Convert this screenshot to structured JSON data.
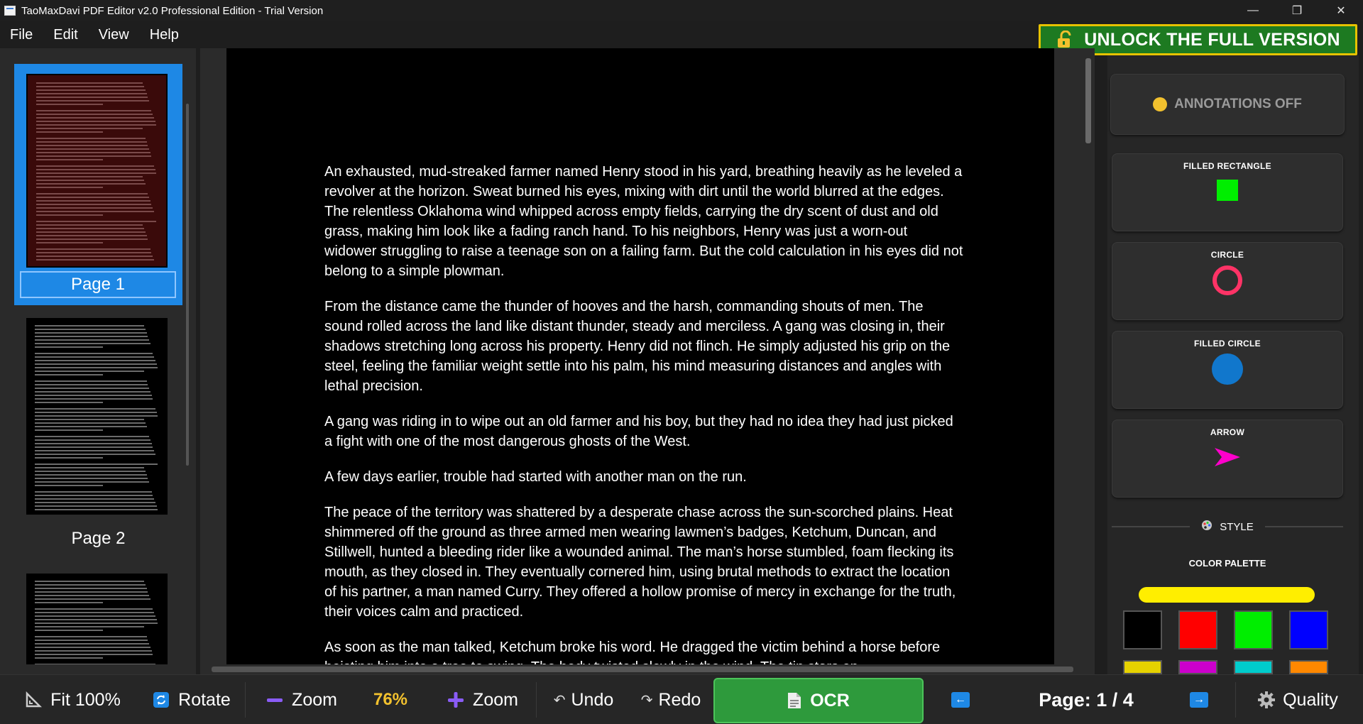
{
  "window": {
    "title": "TaoMaxDavi PDF Editor v2.0 Professional Edition - Trial Version",
    "minimize": "—",
    "restore": "❐",
    "close": "✕"
  },
  "menu": [
    "File",
    "Edit",
    "View",
    "Help"
  ],
  "unlock": {
    "label": "UNLOCK THE FULL VERSION",
    "icon": "unlock-icon"
  },
  "thumbnails": [
    {
      "label": "Page 1",
      "selected": true
    },
    {
      "label": "Page 2",
      "selected": false
    }
  ],
  "document": {
    "paragraphs": [
      "An exhausted, mud-streaked farmer named Henry stood in his yard, breathing heavily as he leveled a revolver at the horizon. Sweat burned his eyes, mixing with dirt until the world blurred at the edges. The relentless Oklahoma wind whipped across empty fields, carrying the dry scent of dust and old grass, making him look like a fading ranch hand. To his neighbors, Henry was just a worn-out widower struggling to raise a teenage son on a failing farm. But the cold calculation in his eyes did not belong to a simple plowman.",
      "From the distance came the thunder of hooves and the harsh, commanding shouts of men. The sound rolled across the land like distant thunder, steady and merciless. A gang was closing in, their shadows stretching long across his property. Henry did not flinch. He simply adjusted his grip on the steel, feeling the familiar weight settle into his palm, his mind measuring distances and angles with lethal precision.",
      "A gang was riding in to wipe out an old farmer and his boy, but they had no idea they had just picked a fight with one of the most dangerous ghosts of the West.",
      "A few days earlier, trouble had started with another man on the run.",
      "The peace of the territory was shattered by a desperate chase across the sun-scorched plains. Heat shimmered off the ground as three armed men wearing lawmen’s badges, Ketchum, Duncan, and Stillwell, hunted a bleeding rider like a wounded animal. The man’s horse stumbled, foam flecking its mouth, as they closed in. They eventually cornered him, using brutal methods to extract the location of his partner, a man named Curry. They offered a hollow promise of mercy in exchange for the truth, their voices calm and practiced.",
      "As soon as the man talked, Ketchum broke his word. He dragged the victim behind a horse before hoisting him into a tree to swing. The body twisted slowly in the wind. The tin stars on"
    ]
  },
  "panel": {
    "annotations": {
      "label": "ANNOTATIONS OFF",
      "dot_color": "#f2c12e"
    },
    "tools": [
      {
        "label": "FILLED RECTANGLE",
        "icon": "filled-rectangle-icon",
        "color": "#00ee00"
      },
      {
        "label": "CIRCLE",
        "icon": "circle-icon",
        "color": "#ff3366"
      },
      {
        "label": "FILLED CIRCLE",
        "icon": "filled-circle-icon",
        "color": "#1177cc"
      },
      {
        "label": "ARROW",
        "icon": "arrow-icon",
        "color": "#ff00cc"
      }
    ],
    "style_label": "STYLE",
    "palette_title": "COLOR PALETTE",
    "selected_color": "#ffee00",
    "swatches": [
      "#000000",
      "#ff0000",
      "#00ee00",
      "#0000ff"
    ],
    "swatches_row2": [
      "#e6d200",
      "#cc00cc",
      "#00cccc",
      "#ff8800"
    ]
  },
  "toolbar": {
    "fit": "Fit 100%",
    "rotate": "Rotate",
    "zoom_out": "Zoom",
    "zoom_level": "76%",
    "zoom_in": "Zoom",
    "undo": "Undo",
    "redo": "Redo",
    "ocr": "OCR",
    "page": "Page: 1 / 4",
    "quality": "Quality"
  }
}
